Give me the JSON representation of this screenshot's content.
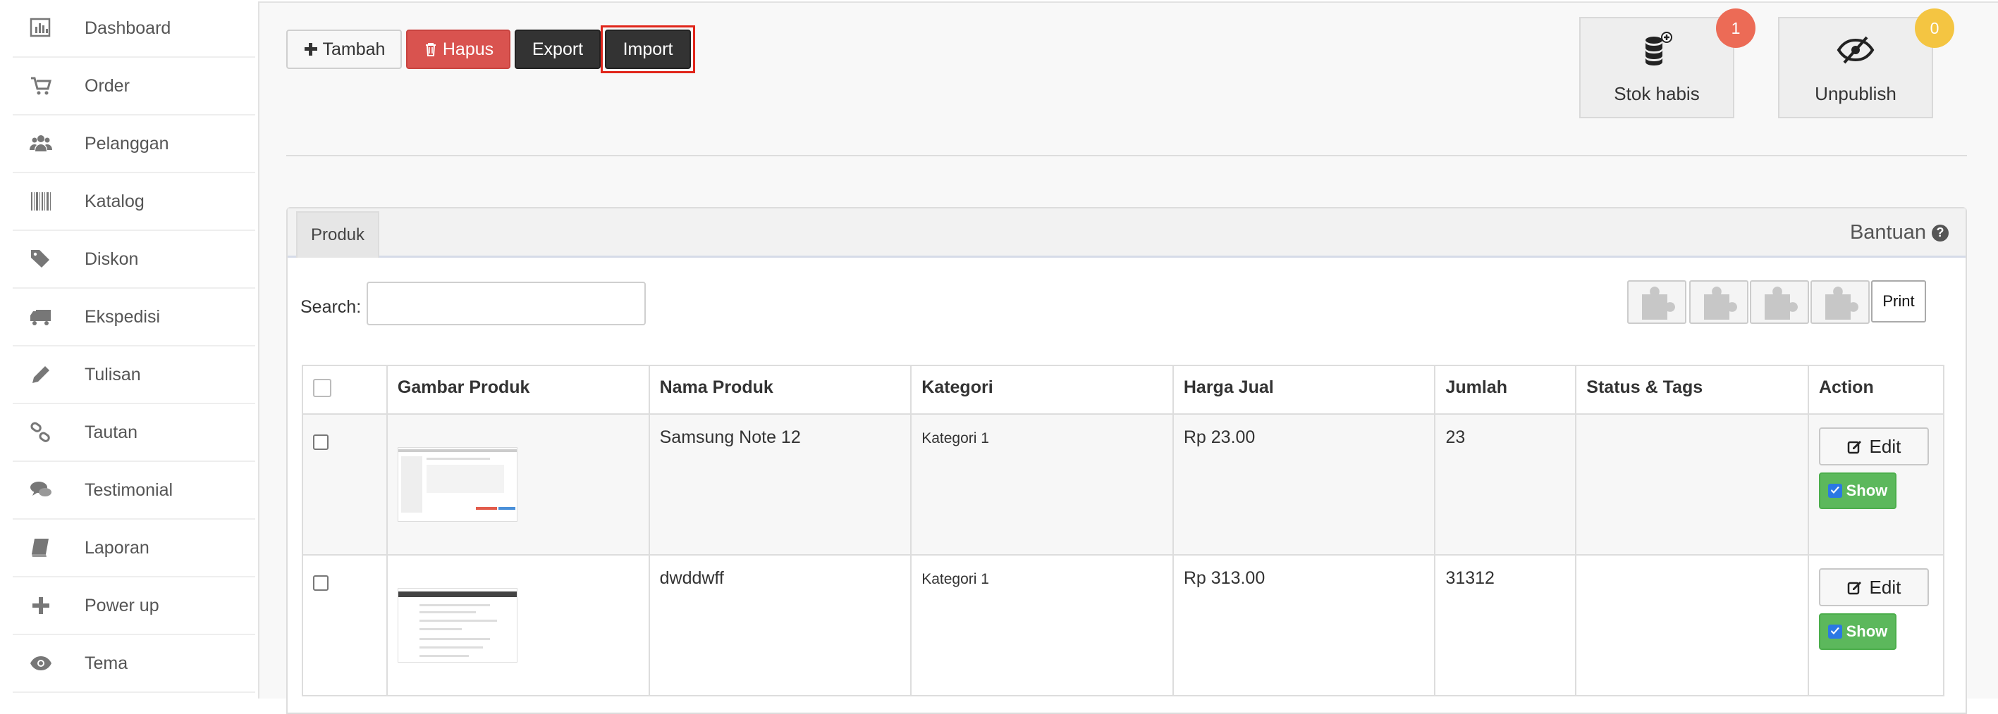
{
  "sidebar": {
    "items": [
      {
        "label": "Dashboard",
        "icon": "bar-chart-icon"
      },
      {
        "label": "Order",
        "icon": "cart-icon"
      },
      {
        "label": "Pelanggan",
        "icon": "users-icon"
      },
      {
        "label": "Katalog",
        "icon": "barcode-icon"
      },
      {
        "label": "Diskon",
        "icon": "tags-icon"
      },
      {
        "label": "Ekspedisi",
        "icon": "truck-icon"
      },
      {
        "label": "Tulisan",
        "icon": "pencil-icon"
      },
      {
        "label": "Tautan",
        "icon": "link-icon"
      },
      {
        "label": "Testimonial",
        "icon": "comments-icon"
      },
      {
        "label": "Laporan",
        "icon": "book-icon"
      },
      {
        "label": "Power up",
        "icon": "plus-icon"
      },
      {
        "label": "Tema",
        "icon": "eye-icon"
      }
    ]
  },
  "toolbar": {
    "tambah_label": "Tambah",
    "hapus_label": "Hapus",
    "export_label": "Export",
    "import_label": "Import"
  },
  "tiles": {
    "stok_habis": {
      "label": "Stok habis",
      "badge": "1",
      "icon": "database-plus-icon"
    },
    "unpublish": {
      "label": "Unpublish",
      "badge": "0",
      "icon": "eye-slash-icon"
    }
  },
  "panel": {
    "tab_label": "Produk",
    "help_label": "Bantuan",
    "search_label": "Search:",
    "search_value": "",
    "print_label": "Print"
  },
  "table": {
    "columns": [
      "Gambar Produk",
      "Nama Produk",
      "Kategori",
      "Harga Jual",
      "Jumlah",
      "Status & Tags",
      "Action"
    ],
    "rows": [
      {
        "nama": "Samsung Note 12",
        "kategori": "Kategori 1",
        "harga": "Rp 23.00",
        "jumlah": "23",
        "status": "",
        "edit": "Edit",
        "show": "Show"
      },
      {
        "nama": "dwddwff",
        "kategori": "Kategori 1",
        "harga": "Rp 313.00",
        "jumlah": "31312",
        "status": "",
        "edit": "Edit",
        "show": "Show"
      }
    ]
  },
  "colors": {
    "hapus": "#d9534f",
    "dark_button": "#333333",
    "import_highlight": "#e0261b",
    "badge_red": "#ec6b56",
    "badge_yellow": "#f4c542",
    "show_green": "#5cb85c"
  }
}
